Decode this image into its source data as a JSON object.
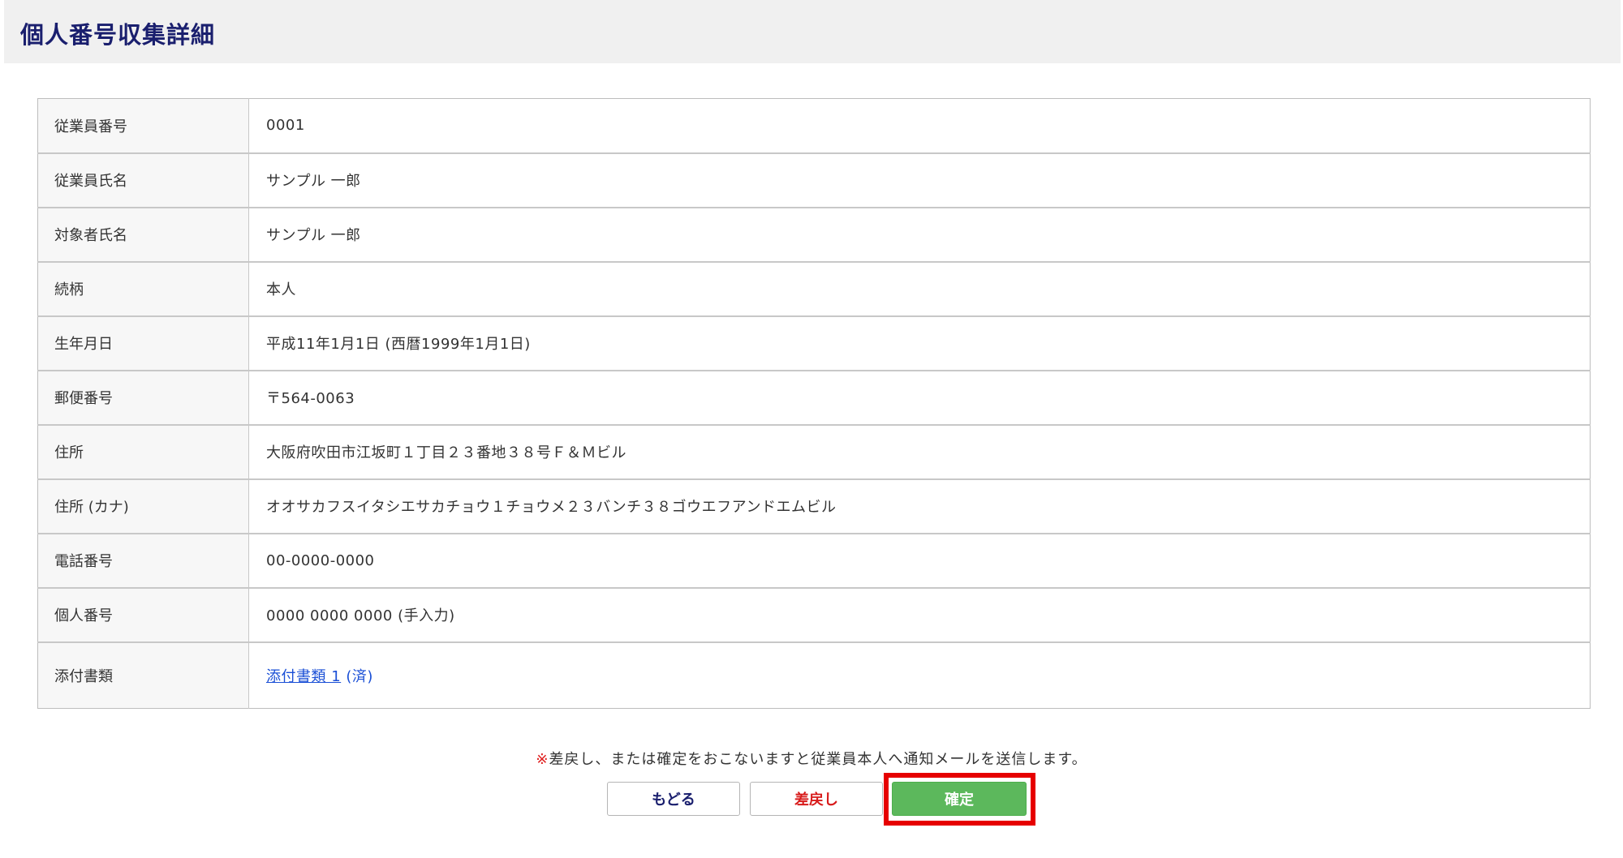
{
  "header": {
    "title": "個人番号収集詳細"
  },
  "details": [
    {
      "label": "従業員番号",
      "value": "0001"
    },
    {
      "label": "従業員氏名",
      "value": "サンプル 一郎"
    },
    {
      "label": "対象者氏名",
      "value": "サンプル 一郎"
    },
    {
      "label": "続柄",
      "value": "本人"
    },
    {
      "label": "生年月日",
      "value": "平成11年1月1日 (西暦1999年1月1日)"
    },
    {
      "label": "郵便番号",
      "value": "〒564-0063"
    },
    {
      "label": "住所",
      "value": "大阪府吹田市江坂町１丁目２３番地３８号Ｆ＆Ｍビル"
    },
    {
      "label": "住所 (カナ)",
      "value": "オオサカフスイタシエサカチョウ１チョウメ２３バンチ３８ゴウエフアンドエムビル"
    },
    {
      "label": "電話番号",
      "value": "00-0000-0000"
    },
    {
      "label": "個人番号",
      "value": "0000 0000 0000 (手入力)"
    },
    {
      "label": "添付書類",
      "link_text": "添付書類 1",
      "link_suffix": " (済)"
    }
  ],
  "notice": {
    "mark": "※",
    "text": "差戻し、または確定をおこないますと従業員本人へ通知メールを送信します。"
  },
  "buttons": {
    "back": "もどる",
    "reject": "差戻し",
    "confirm": "確定"
  },
  "colors": {
    "title": "#1a1f6e",
    "confirm_button": "#5cb85c",
    "reject_text": "#d81b1b",
    "highlight_border": "#e60000",
    "link": "#1a4fd6"
  }
}
